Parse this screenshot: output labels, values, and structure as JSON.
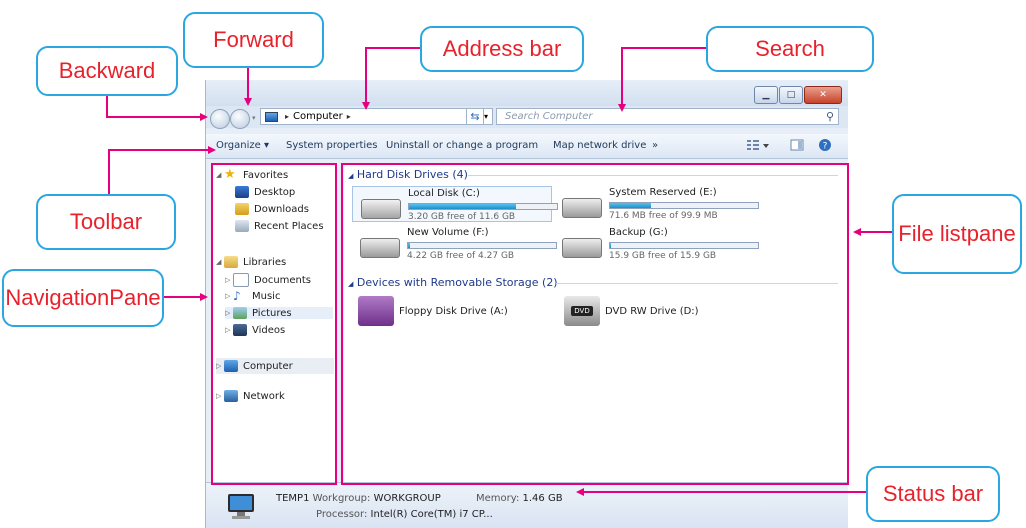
{
  "callouts": {
    "backward": "Backward",
    "forward": "Forward",
    "address_bar": "Address bar",
    "search": "Search",
    "toolbar": "Toolbar",
    "navigation_pane": [
      "Navigation",
      "Pane"
    ],
    "file_list_pane": [
      "File list",
      "pane"
    ],
    "status_bar": "Status bar"
  },
  "address": {
    "location": "Computer",
    "separator": "▸"
  },
  "search": {
    "placeholder": "Search Computer"
  },
  "toolbar": {
    "organize": "Organize ▾",
    "system_properties": "System properties",
    "uninstall": "Uninstall or change a program",
    "map_drive": "Map network drive",
    "more": "»"
  },
  "nav": {
    "favorites": "Favorites",
    "desktop": "Desktop",
    "downloads": "Downloads",
    "recent": "Recent Places",
    "libraries": "Libraries",
    "documents": "Documents",
    "music": "Music",
    "pictures": "Pictures",
    "videos": "Videos",
    "computer": "Computer",
    "network": "Network"
  },
  "files": {
    "hdd_group": "Hard Disk Drives (4)",
    "removable_group": "Devices with Removable Storage (2)",
    "drives": [
      {
        "name": "Local Disk (C:)",
        "free": "3.20 GB free of 11.6 GB",
        "used_fraction": 0.72
      },
      {
        "name": "System Reserved (E:)",
        "free": "71.6 MB free of 99.9 MB",
        "used_fraction": 0.28
      },
      {
        "name": "New Volume (F:)",
        "free": "4.22 GB free of 4.27 GB",
        "used_fraction": 0.012
      },
      {
        "name": "Backup (G:)",
        "free": "15.9 GB free of 15.9 GB",
        "used_fraction": 0.005
      }
    ],
    "floppy": "Floppy Disk Drive (A:)",
    "dvd": "DVD RW Drive (D:)",
    "dvd_icon_text": "DVD"
  },
  "status": {
    "computer_name": "TEMP1",
    "workgroup_label": "Workgroup:",
    "workgroup": "WORKGROUP",
    "memory_label": "Memory:",
    "memory": "1.46 GB",
    "processor_label": "Processor:",
    "processor": "Intel(R) Core(TM) i7 CP..."
  },
  "colors": {
    "callout_border": "#2aa6e0",
    "callout_text": "#e8222c",
    "arrow": "#e6007e",
    "highlight_box": "#e6007e"
  }
}
